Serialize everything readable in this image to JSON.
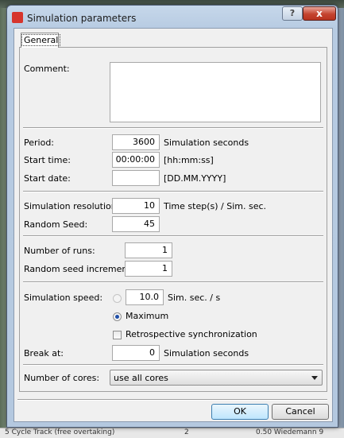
{
  "window": {
    "app_icon_text": "",
    "title": "Simulation parameters",
    "help_label": "?",
    "close_label": "x"
  },
  "tabs": [
    {
      "label": "General"
    }
  ],
  "form": {
    "comment_label": "Comment:",
    "comment_value": "",
    "period_label": "Period:",
    "period_value": "3600",
    "period_unit": "Simulation seconds",
    "start_time_label": "Start time:",
    "start_time_value": "00:00:00",
    "start_time_unit": "[hh:mm:ss]",
    "start_date_label": "Start date:",
    "start_date_value": "",
    "start_date_unit": "[DD.MM.YYYY]",
    "resolution_label": "Simulation resolution:",
    "resolution_value": "10",
    "resolution_unit": "Time step(s) / Sim. sec.",
    "random_seed_label": "Random Seed:",
    "random_seed_value": "45",
    "num_runs_label": "Number of runs:",
    "num_runs_value": "1",
    "seed_increment_label": "Random seed increment:",
    "seed_increment_value": "1",
    "sim_speed_label": "Simulation speed:",
    "sim_speed_value": "10.0",
    "sim_speed_unit": "Sim. sec. / s",
    "maximum_label": "Maximum",
    "retro_sync_label": "Retrospective synchronization",
    "break_at_label": "Break at:",
    "break_at_value": "0",
    "break_at_unit": "Simulation seconds",
    "cores_label": "Number of cores:",
    "cores_value": "use all cores"
  },
  "buttons": {
    "ok": "OK",
    "cancel": "Cancel"
  },
  "background": {
    "bottom_text_1": "5 Cycle Track (free overtaking)",
    "bottom_text_2": "2",
    "bottom_text_3": "0.50 Wiedemann 9"
  },
  "state": {
    "sim_speed_mode": "Maximum",
    "retro_sync_checked": false
  }
}
